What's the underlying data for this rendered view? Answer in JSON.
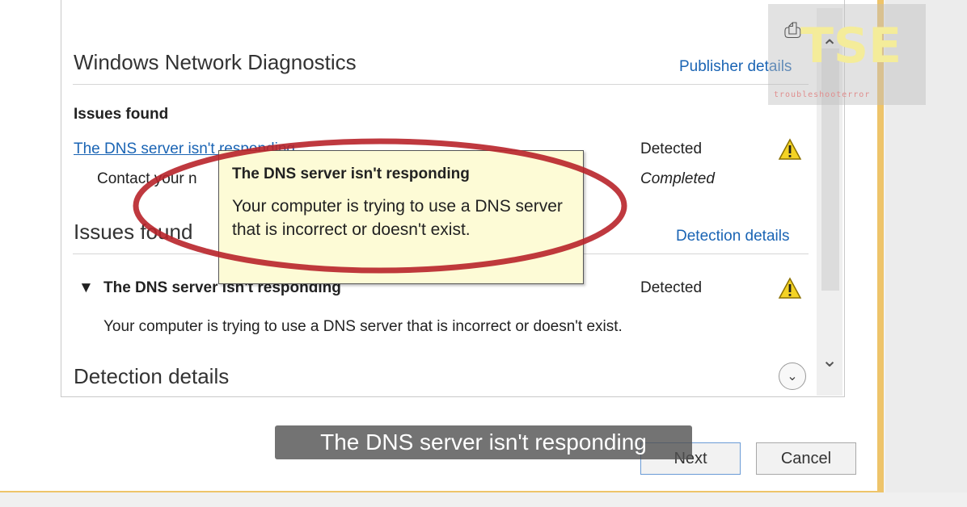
{
  "dialog": {
    "title": "Windows Network Diagnostics",
    "publisher_link": "Publisher details",
    "issues_heading_small": "Issues found",
    "issue_link": "The DNS server isn't responding",
    "issue_status": "Detected",
    "sub_item_text": "Contact your n",
    "sub_item_status": "Completed",
    "issues_heading_large": "Issues found",
    "detection_link": "Detection details",
    "expanded_issue_title": "The DNS server isn't responding",
    "expanded_issue_status": "Detected",
    "expanded_issue_desc": "Your computer is trying to use a DNS server that is incorrect or doesn't exist.",
    "detection_heading": "Detection details"
  },
  "tooltip": {
    "title": "The DNS server isn't responding",
    "body": "Your computer is trying to use a DNS server that is incorrect or doesn't exist."
  },
  "buttons": {
    "next": "Next",
    "cancel": "Cancel"
  },
  "caption": "The DNS server isn't responding",
  "watermark": {
    "logo": "TSE",
    "tagline": "troubleshooterror"
  },
  "icons": {
    "warning": "warning-icon",
    "printer": "printer-icon",
    "expand": "chevron-down-circle-icon"
  },
  "colors": {
    "link": "#1a64b4",
    "highlight_ellipse": "#b8242a",
    "tooltip_bg": "#fdfbd6",
    "frame": "#eec46a"
  }
}
